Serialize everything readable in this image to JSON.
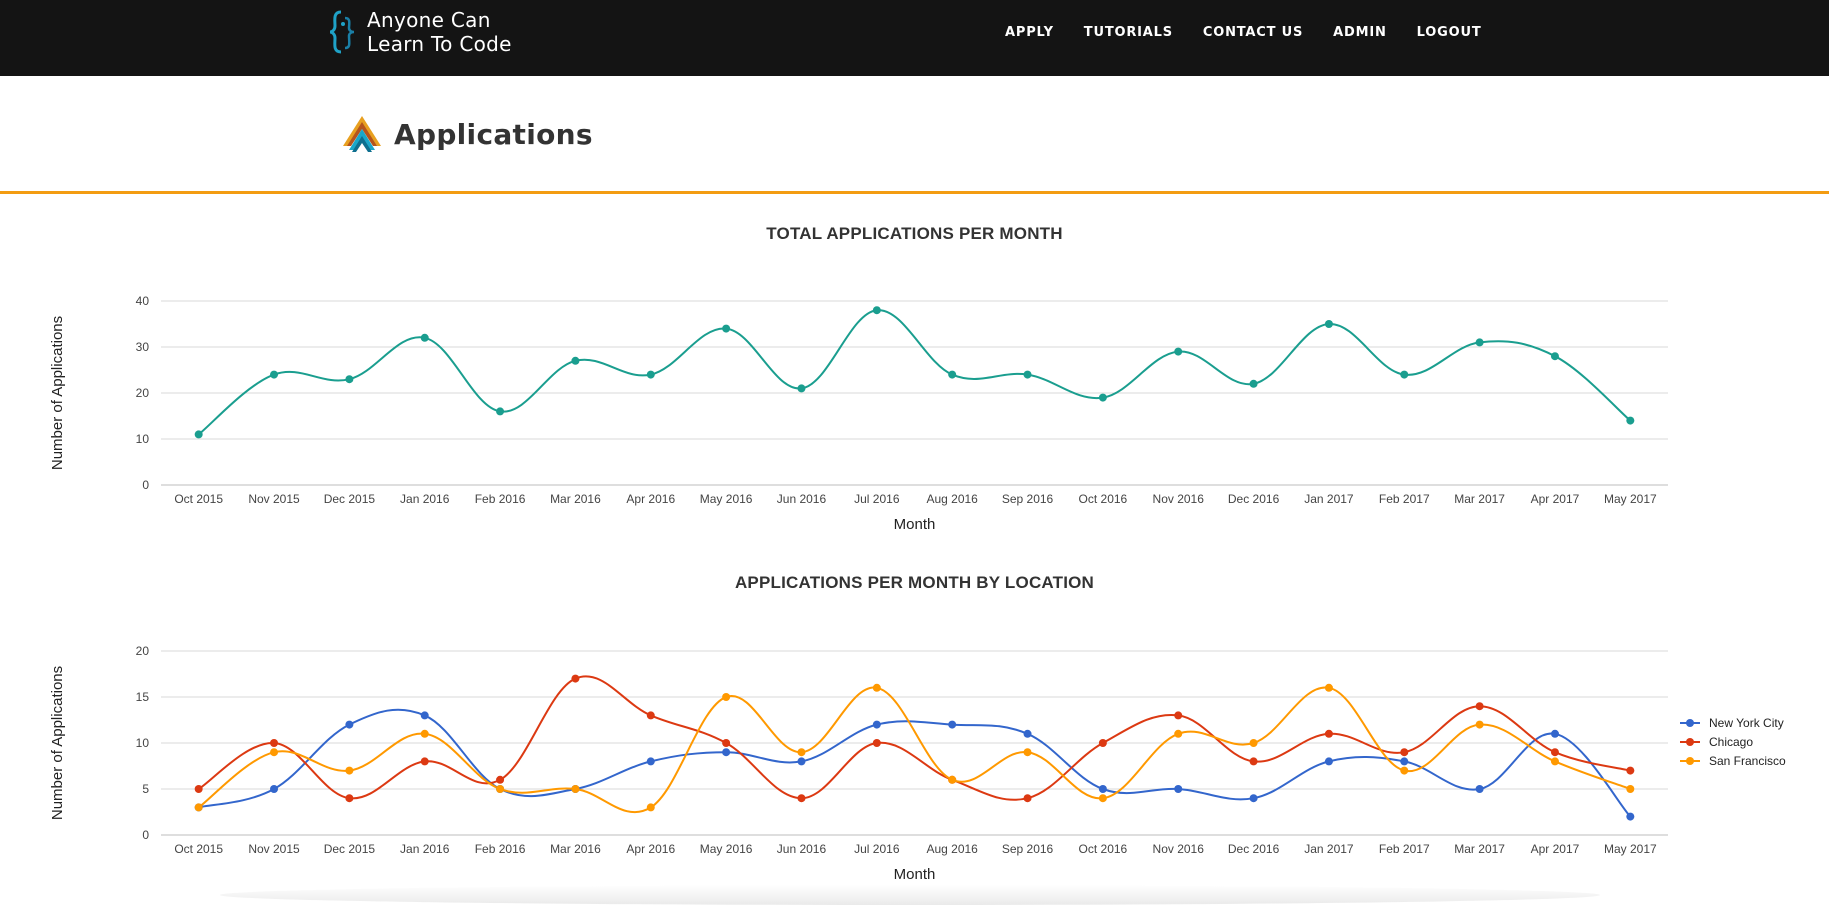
{
  "brand": {
    "line1": "Anyone Can",
    "line2": "Learn To Code"
  },
  "nav": {
    "items": [
      "APPLY",
      "TUTORIALS",
      "CONTACT US",
      "ADMIN",
      "LOGOUT"
    ]
  },
  "page": {
    "title": "Applications"
  },
  "chart_data": [
    {
      "type": "line",
      "title": "TOTAL APPLICATIONS PER MONTH",
      "xlabel": "Month",
      "ylabel": "Number of Applications",
      "ylim": [
        0,
        40
      ],
      "yticks": [
        0,
        10,
        20,
        30,
        40
      ],
      "grid": true,
      "categories": [
        "Oct 2015",
        "Nov 2015",
        "Dec 2015",
        "Jan 2016",
        "Feb 2016",
        "Mar 2016",
        "Apr 2016",
        "May 2016",
        "Jun 2016",
        "Jul 2016",
        "Aug 2016",
        "Sep 2016",
        "Oct 2016",
        "Nov 2016",
        "Dec 2016",
        "Jan 2017",
        "Feb 2017",
        "Mar 2017",
        "Apr 2017",
        "May 2017"
      ],
      "series": [
        {
          "color": "#1a9e8f",
          "values": [
            11,
            24,
            23,
            32,
            16,
            27,
            24,
            34,
            21,
            38,
            24,
            24,
            19,
            29,
            22,
            35,
            24,
            31,
            28,
            14
          ]
        }
      ]
    },
    {
      "type": "line",
      "title": "APPLICATIONS PER MONTH BY LOCATION",
      "xlabel": "Month",
      "ylabel": "Number of Applications",
      "ylim": [
        0,
        20
      ],
      "yticks": [
        0,
        5,
        10,
        15,
        20
      ],
      "grid": true,
      "legend": "right",
      "categories": [
        "Oct 2015",
        "Nov 2015",
        "Dec 2015",
        "Jan 2016",
        "Feb 2016",
        "Mar 2016",
        "Apr 2016",
        "May 2016",
        "Jun 2016",
        "Jul 2016",
        "Aug 2016",
        "Sep 2016",
        "Oct 2016",
        "Nov 2016",
        "Dec 2016",
        "Jan 2017",
        "Feb 2017",
        "Mar 2017",
        "Apr 2017",
        "May 2017"
      ],
      "series": [
        {
          "name": "New York City",
          "color": "#3366cc",
          "values": [
            3,
            5,
            12,
            13,
            5,
            5,
            8,
            9,
            8,
            12,
            12,
            11,
            5,
            5,
            4,
            8,
            8,
            5,
            11,
            2
          ]
        },
        {
          "name": "Chicago",
          "color": "#dc3912",
          "values": [
            5,
            10,
            4,
            8,
            6,
            17,
            13,
            10,
            4,
            10,
            6,
            4,
            10,
            13,
            8,
            11,
            9,
            14,
            9,
            7
          ]
        },
        {
          "name": "San Francisco",
          "color": "#ff9900",
          "values": [
            3,
            9,
            7,
            11,
            5,
            5,
            3,
            15,
            9,
            16,
            6,
            9,
            4,
            11,
            10,
            16,
            7,
            12,
            8,
            5
          ]
        }
      ]
    }
  ]
}
